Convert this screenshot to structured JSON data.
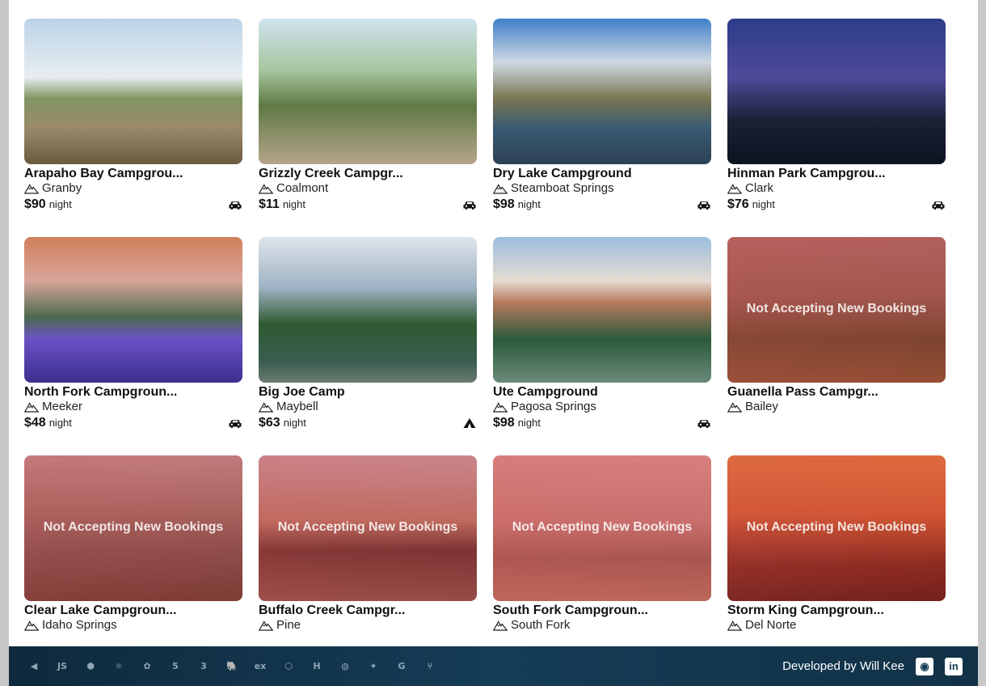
{
  "campgrounds": [
    {
      "name": "Arapaho Bay Campgrou...",
      "location": "Granby",
      "price": "$90",
      "per": "night",
      "type": "car-icon",
      "closed": false
    },
    {
      "name": "Grizzly Creek Campgr...",
      "location": "Coalmont",
      "price": "$11",
      "per": "night",
      "type": "car-icon",
      "closed": false
    },
    {
      "name": "Dry Lake Campground",
      "location": "Steamboat Springs",
      "price": "$98",
      "per": "night",
      "type": "car-icon",
      "closed": false
    },
    {
      "name": "Hinman Park Campgrou...",
      "location": "Clark",
      "price": "$76",
      "per": "night",
      "type": "car-icon",
      "closed": false
    },
    {
      "name": "North Fork Campgroun...",
      "location": "Meeker",
      "price": "$48",
      "per": "night",
      "type": "car-icon",
      "closed": false
    },
    {
      "name": "Big Joe Camp",
      "location": "Maybell",
      "price": "$63",
      "per": "night",
      "type": "tent-icon",
      "closed": false
    },
    {
      "name": "Ute Campground",
      "location": "Pagosa Springs",
      "price": "$98",
      "per": "night",
      "type": "car-icon",
      "closed": false
    },
    {
      "name": "Guanella Pass Campgr...",
      "location": "Bailey",
      "closed": true
    },
    {
      "name": "Clear Lake Campgroun...",
      "location": "Idaho Springs",
      "closed": true
    },
    {
      "name": "Buffalo Creek Campgr...",
      "location": "Pine",
      "closed": true
    },
    {
      "name": "South Fork Campgroun...",
      "location": "South Fork",
      "closed": true
    },
    {
      "name": "Storm King Campgroun...",
      "location": "Del Norte",
      "closed": true
    }
  ],
  "closed_label": "Not Accepting New Bookings",
  "footer": {
    "credit": "Developed by Will Kee",
    "tech_icons": [
      "vscode-icon",
      "javascript-icon",
      "nodejs-icon",
      "react-icon",
      "redux-icon",
      "html5-icon",
      "css3-icon",
      "postgresql-icon",
      "express-icon",
      "sequelize-icon",
      "heroku-icon",
      "render-icon",
      "figma-icon",
      "google-icon",
      "git-icon"
    ],
    "social": [
      "github-icon",
      "linkedin-icon"
    ]
  },
  "colors": {
    "page_bg": "#c8c8c8",
    "card_bg": "#ffffff",
    "closed_tint": "#cd3c3c",
    "footer_bg": "#153c56"
  }
}
